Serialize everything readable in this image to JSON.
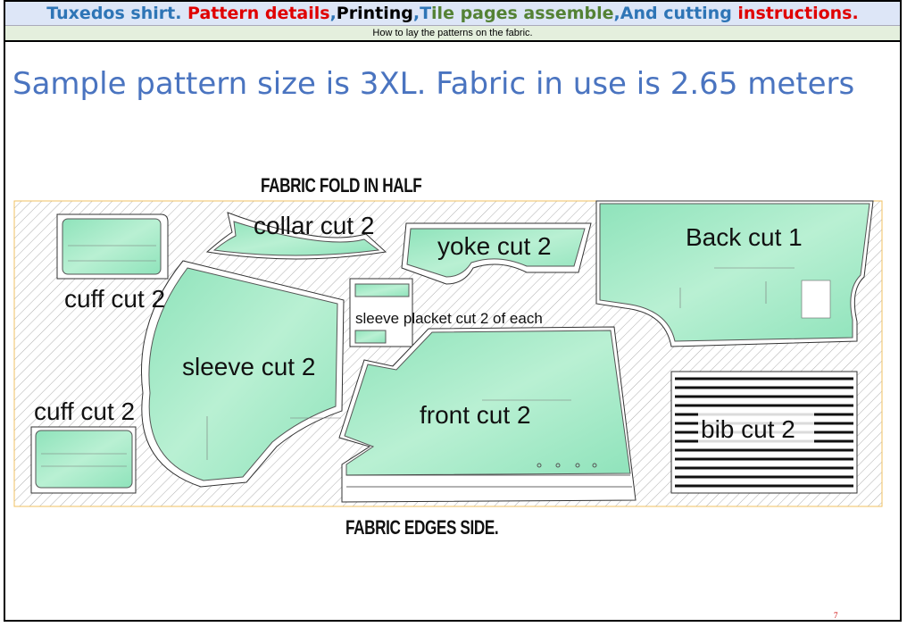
{
  "header": {
    "title_parts": [
      {
        "text": "Tuxedos shirt. ",
        "color": "#2e75b6"
      },
      {
        "text": "Pattern details",
        "color": "#e00000"
      },
      {
        "text": ",",
        "color": "#2e75b6"
      },
      {
        "text": "Printing",
        "color": "#000000"
      },
      {
        "text": ",",
        "color": "#2e75b6"
      },
      {
        "text": "T",
        "color": "#2e75b6"
      },
      {
        "text": "ile pages assemble",
        "color": "#548235"
      },
      {
        "text": ",And cutting ",
        "color": "#2e75b6"
      },
      {
        "text": "instructions.",
        "color": "#e00000"
      }
    ],
    "subtitle": "How to lay the patterns on the fabric."
  },
  "headline": "Sample pattern size is 3XL. Fabric in use is 2.65 meters",
  "diagram": {
    "fold_label": "FABRIC  FOLD IN HALF",
    "edge_label": "FABRIC  EDGES SIDE.",
    "pieces": {
      "cuff_top": "cuff cut 2",
      "cuff_bottom": "cuff cut 2",
      "collar": "collar cut 2",
      "yoke": "yoke cut 2",
      "back": "Back cut 1",
      "sleeve": "sleeve cut 2",
      "placket": "sleeve placket cut 2 of each",
      "front": "front  cut 2",
      "bib": "bib   cut 2"
    },
    "colors": {
      "piece_fill": "#a8ecc9",
      "fabric_border": "#f0c060",
      "hatch": "#999999"
    }
  },
  "page_number": "7"
}
